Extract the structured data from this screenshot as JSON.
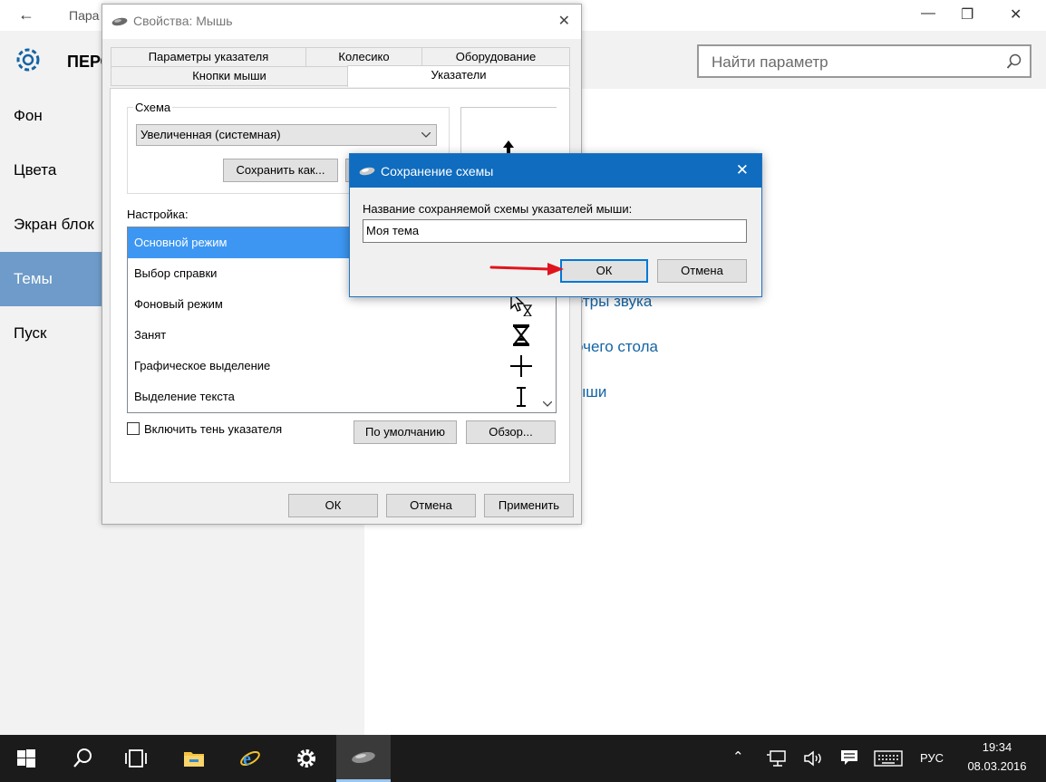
{
  "settings": {
    "title": "Пара",
    "heading": "ПЕРС",
    "search_placeholder": "Найти параметр",
    "nav": [
      "Фон",
      "Цвета",
      "Экран блок",
      "Темы",
      "Пуск"
    ],
    "active_nav": "Темы",
    "links": [
      "етры звука",
      "очего стола",
      "ыши"
    ]
  },
  "mouse_dialog": {
    "title": "Свойства: Мышь",
    "tabs_row1": [
      "Параметры указателя",
      "Колесико",
      "Оборудование"
    ],
    "tabs_row2": [
      "Кнопки мыши",
      "Указатели"
    ],
    "selected_tab": "Указатели",
    "scheme_label": "Схема",
    "scheme_value": "Увеличенная (системная)",
    "save_as_label": "Сохранить как...",
    "customize_label": "Настройка:",
    "cursor_rows": [
      {
        "label": "Основной режим",
        "icon": "arrow-cursor-icon"
      },
      {
        "label": "Выбор справки",
        "icon": "help-cursor-icon"
      },
      {
        "label": "Фоновый режим",
        "icon": "working-cursor-icon"
      },
      {
        "label": "Занят",
        "icon": "hourglass-cursor-icon"
      },
      {
        "label": "Графическое выделение",
        "icon": "crosshair-cursor-icon"
      },
      {
        "label": "Выделение текста",
        "icon": "text-cursor-icon"
      }
    ],
    "selected_row": "Основной режим",
    "shadow_checkbox": "Включить тень указателя",
    "shadow_checked": false,
    "default_button": "По умолчанию",
    "browse_button": "Обзор...",
    "ok": "ОК",
    "cancel": "Отмена",
    "apply": "Применить"
  },
  "save_dialog": {
    "title": "Сохранение схемы",
    "prompt": "Название сохраняемой схемы указателей мыши:",
    "value": "Моя тема",
    "ok": "ОК",
    "cancel": "Отмена"
  },
  "taskbar": {
    "lang": "РУС",
    "time": "19:34",
    "date": "08.03.2016"
  },
  "colors": {
    "accent": "#0f6cbf",
    "selection": "#3d97f2",
    "nav_active": "#6e9bc9",
    "link": "#1464a5",
    "arrow": "#e0141e"
  }
}
